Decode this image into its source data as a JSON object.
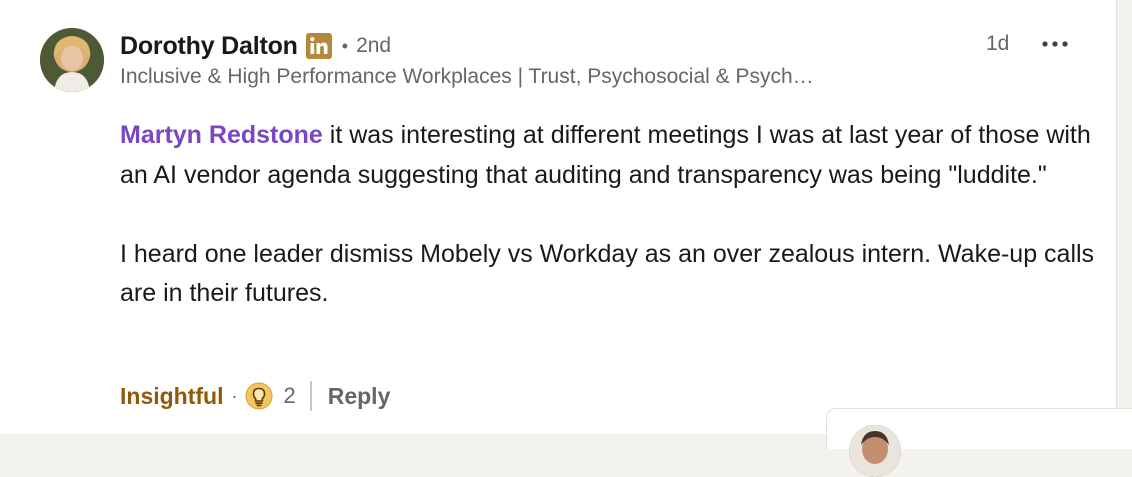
{
  "comment": {
    "author": {
      "name": "Dorothy Dalton",
      "degree": "2nd",
      "headline": "Inclusive & High Performance Workplaces | Trust, Psychosocial & Psych…",
      "badge_icon": "linkedin-icon"
    },
    "timestamp": "1d",
    "menu_icon": "more-horizontal-icon",
    "mention": "Martyn Redstone",
    "paragraph1_rest": " it was interesting at different meetings I was at last year of those with an AI vendor agenda suggesting that auditing and transparency was being \"luddite.\"",
    "paragraph2": "I heard one leader dismiss Mobely vs Workday as an over zealous intern. Wake-up calls are in their futures."
  },
  "actions": {
    "reaction_label": "Insightful",
    "reaction_icon": "lightbulb-icon",
    "reaction_count": "2",
    "reply_label": "Reply"
  },
  "colors": {
    "mention": "#7b46c4",
    "insightful": "#915907",
    "linkedin_badge": "#b38a3c",
    "muted_text": "#666666"
  }
}
